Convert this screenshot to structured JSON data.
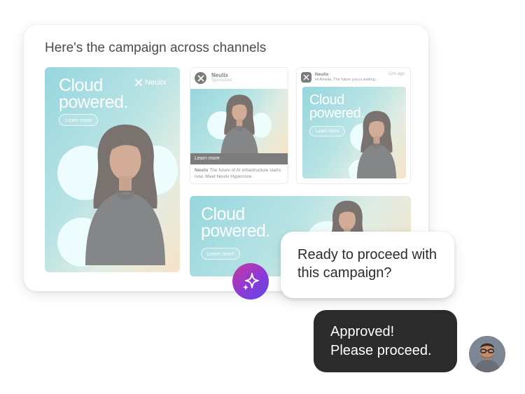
{
  "panel": {
    "title": "Here's the campaign across channels"
  },
  "ads": {
    "headline_line1": "Cloud",
    "headline_line2": "powered.",
    "cta": "Learn more",
    "brand": "Neulix"
  },
  "social_post": {
    "brand": "Neulix",
    "sponsored": "Sponsored",
    "cta_bar": "Learn more",
    "caption_brand": "Neulix",
    "caption": "The future of AI infrastructure starts now. Meet Neulix Hypercore."
  },
  "email_notification": {
    "sender": "Neulix",
    "time": "12m ago",
    "preview": "Hi Amelia, The future you is waiting..."
  },
  "chat": {
    "assistant_line1": "Ready to proceed with",
    "assistant_line2": "this campaign?",
    "user_line1": "Approved!",
    "user_line2": "Please proceed."
  },
  "colors": {
    "ad_teal": "#57bfcb",
    "ad_peach": "#f4d2a8",
    "user_bubble": "#2b2b2b",
    "ai_gradient_start": "#c83a9f",
    "ai_gradient_end": "#5b49e8"
  },
  "icons": {
    "brand_logo": "neulix-logo-icon",
    "ai_assistant": "sparkle-icon",
    "user_avatar": "avatar"
  }
}
